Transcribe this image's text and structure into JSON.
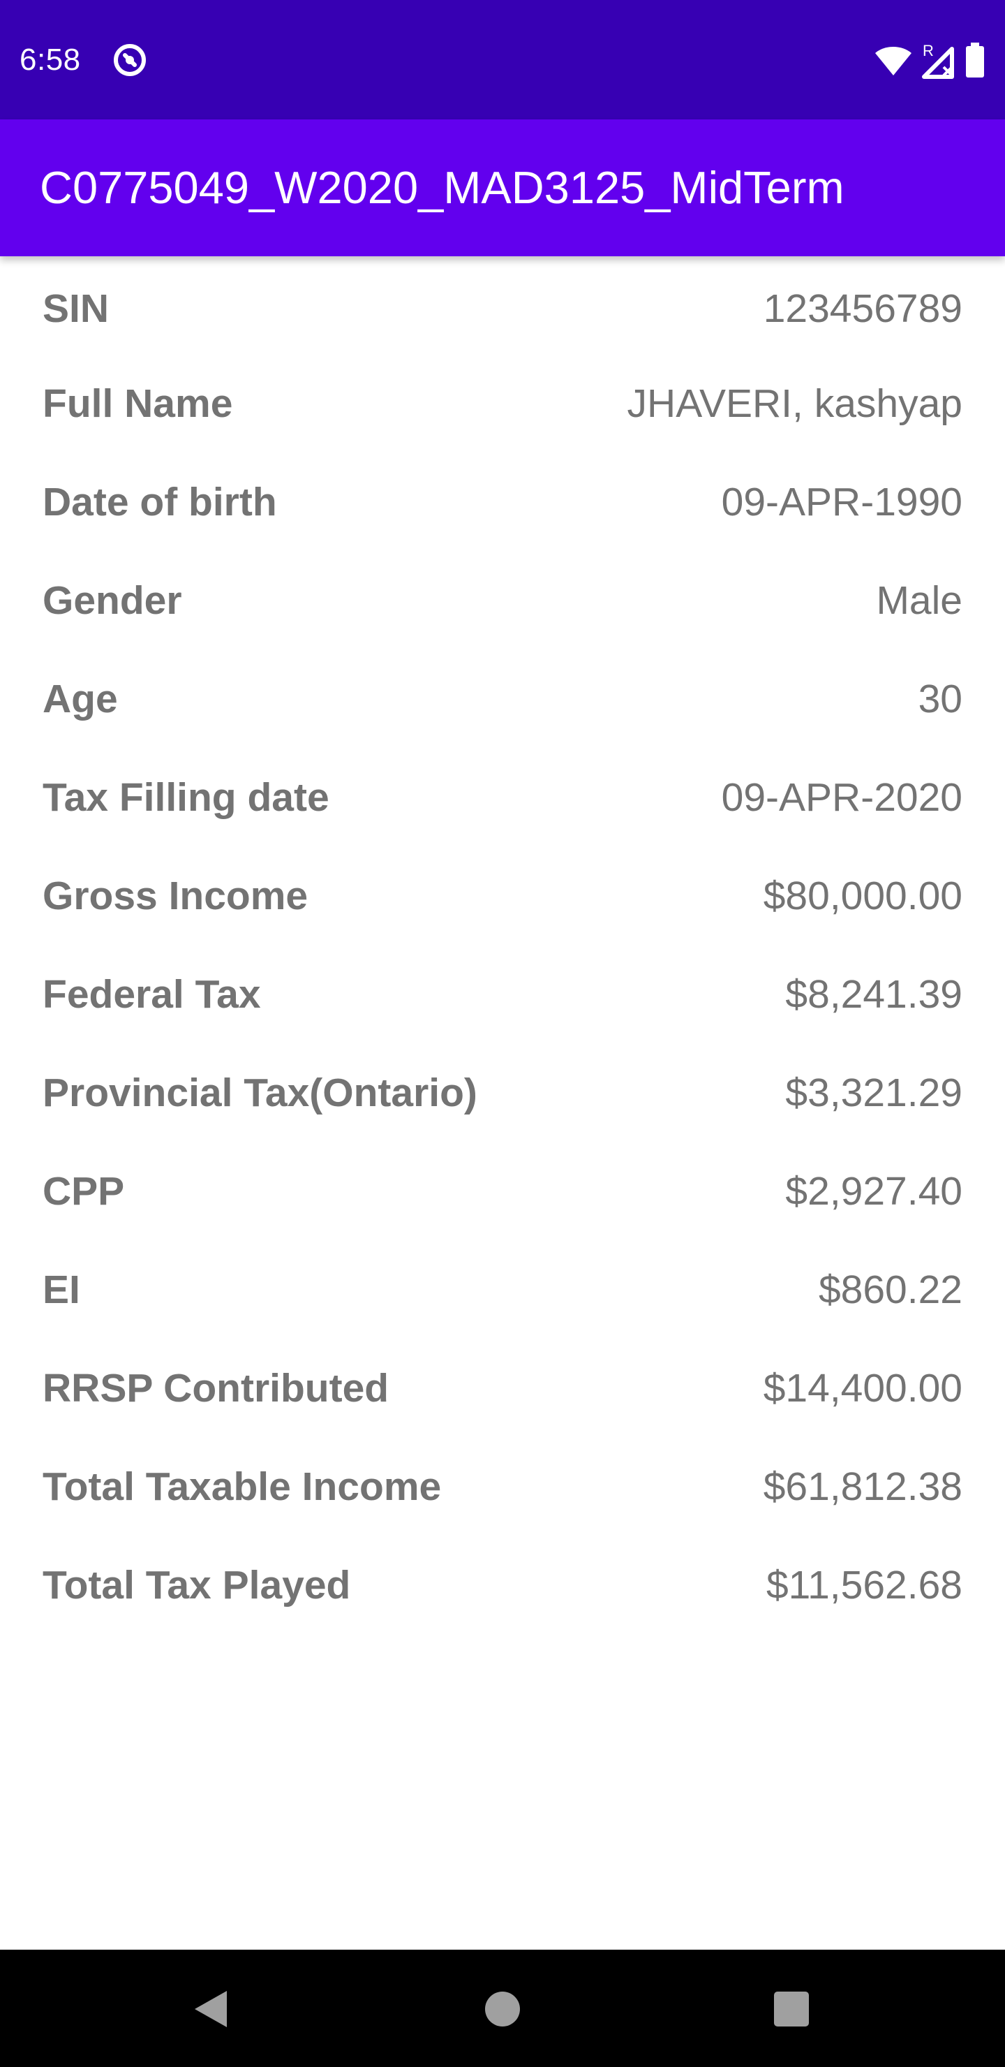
{
  "status_bar": {
    "time": "6:58",
    "app_icon": "notification-at-icon",
    "icons": [
      "wifi-icon",
      "signal-roaming-icon",
      "battery-icon"
    ],
    "signal_badge": "R"
  },
  "app_bar": {
    "title": "C0775049_W2020_MAD3125_MidTerm",
    "color": "#6200ee"
  },
  "details": [
    {
      "label": "SIN",
      "value": "123456789"
    },
    {
      "label": "Full Name",
      "value": "JHAVERI, kashyap"
    },
    {
      "label": "Date of birth",
      "value": "09-APR-1990"
    },
    {
      "label": "Gender",
      "value": "Male"
    },
    {
      "label": "Age",
      "value": "30"
    },
    {
      "label": "Tax Filling date",
      "value": "09-APR-2020"
    },
    {
      "label": "Gross Income",
      "value": "$80,000.00"
    },
    {
      "label": "Federal Tax",
      "value": "$8,241.39"
    },
    {
      "label": "Provincial Tax(Ontario)",
      "value": "$3,321.29"
    },
    {
      "label": "CPP",
      "value": "$2,927.40"
    },
    {
      "label": "EI",
      "value": "$860.22"
    },
    {
      "label": "RRSP Contributed",
      "value": "$14,400.00"
    },
    {
      "label": "Total Taxable Income",
      "value": "$61,812.38"
    },
    {
      "label": "Total Tax Played",
      "value": "$11,562.68"
    }
  ],
  "nav_bar": {
    "buttons": [
      "back-icon",
      "home-icon",
      "recents-icon"
    ]
  }
}
